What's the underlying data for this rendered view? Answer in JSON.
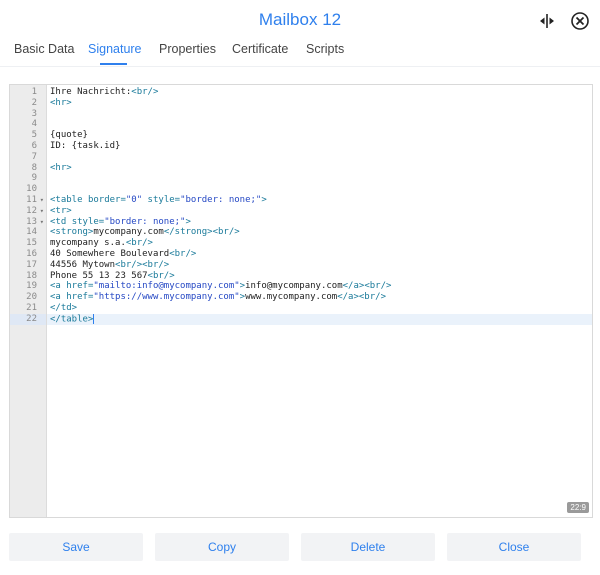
{
  "header": {
    "title": "Mailbox 12"
  },
  "tabs": [
    {
      "label": "Basic Data"
    },
    {
      "label": "Signature"
    },
    {
      "label": "Properties"
    },
    {
      "label": "Certificate"
    },
    {
      "label": "Scripts"
    }
  ],
  "icons": {
    "resize": "split-resize-icon",
    "close": "close-circle-icon"
  },
  "editor": {
    "active_line": 22,
    "cursor_position": "22:9",
    "lines": [
      {
        "n": "1",
        "fold": "",
        "segs": [
          [
            "txt",
            "Ihre Nachricht:"
          ],
          [
            "tag",
            "<br/>"
          ]
        ]
      },
      {
        "n": "2",
        "fold": "",
        "segs": [
          [
            "tag",
            "<hr>"
          ]
        ]
      },
      {
        "n": "3",
        "fold": "",
        "segs": []
      },
      {
        "n": "4",
        "fold": "",
        "segs": []
      },
      {
        "n": "5",
        "fold": "",
        "segs": [
          [
            "txt",
            "{quote}"
          ]
        ]
      },
      {
        "n": "6",
        "fold": "",
        "segs": [
          [
            "txt",
            "ID: {task.id}"
          ]
        ]
      },
      {
        "n": "7",
        "fold": "",
        "segs": []
      },
      {
        "n": "8",
        "fold": "",
        "segs": [
          [
            "tag",
            "<hr>"
          ]
        ]
      },
      {
        "n": "9",
        "fold": "",
        "segs": []
      },
      {
        "n": "10",
        "fold": "",
        "segs": []
      },
      {
        "n": "11",
        "fold": "▾",
        "segs": [
          [
            "tag",
            "<table "
          ],
          [
            "attr",
            "border="
          ],
          [
            "str",
            "\"0\""
          ],
          [
            "attr",
            " style="
          ],
          [
            "str",
            "\"border: none;\""
          ],
          [
            "tag",
            ">"
          ]
        ]
      },
      {
        "n": "12",
        "fold": "▾",
        "segs": [
          [
            "tag",
            "<tr>"
          ]
        ]
      },
      {
        "n": "13",
        "fold": "▾",
        "segs": [
          [
            "tag",
            "<td "
          ],
          [
            "attr",
            "style="
          ],
          [
            "str",
            "\"border: none;\""
          ],
          [
            "tag",
            ">"
          ]
        ]
      },
      {
        "n": "14",
        "fold": "",
        "segs": [
          [
            "tag",
            "<strong>"
          ],
          [
            "txt",
            "mycompany.com"
          ],
          [
            "tag",
            "</strong><br/>"
          ]
        ]
      },
      {
        "n": "15",
        "fold": "",
        "segs": [
          [
            "txt",
            "mycompany s.a."
          ],
          [
            "tag",
            "<br/>"
          ]
        ]
      },
      {
        "n": "16",
        "fold": "",
        "segs": [
          [
            "txt",
            "40 Somewhere Boulevard"
          ],
          [
            "tag",
            "<br/>"
          ]
        ]
      },
      {
        "n": "17",
        "fold": "",
        "segs": [
          [
            "txt",
            "44556 Mytown"
          ],
          [
            "tag",
            "<br/><br/>"
          ]
        ]
      },
      {
        "n": "18",
        "fold": "",
        "segs": [
          [
            "txt",
            "Phone 55 13 23 567"
          ],
          [
            "tag",
            "<br/>"
          ]
        ]
      },
      {
        "n": "19",
        "fold": "",
        "segs": [
          [
            "tag",
            "<a "
          ],
          [
            "attr",
            "href="
          ],
          [
            "str",
            "\"mailto:info@mycompany.com\""
          ],
          [
            "tag",
            ">"
          ],
          [
            "txt",
            "info@mycompany.com"
          ],
          [
            "tag",
            "</a><br/>"
          ]
        ]
      },
      {
        "n": "20",
        "fold": "",
        "segs": [
          [
            "tag",
            "<a "
          ],
          [
            "attr",
            "href="
          ],
          [
            "str",
            "\"https://www.mycompany.com\""
          ],
          [
            "tag",
            ">"
          ],
          [
            "txt",
            "www.mycompany.com"
          ],
          [
            "tag",
            "</a><br/>"
          ]
        ]
      },
      {
        "n": "21",
        "fold": "",
        "segs": [
          [
            "tag",
            "</td>"
          ]
        ]
      },
      {
        "n": "22",
        "fold": "",
        "segs": [
          [
            "tag",
            "</table>"
          ]
        ]
      }
    ]
  },
  "buttons": {
    "save": "Save",
    "copy": "Copy",
    "delete": "Delete",
    "close": "Close"
  },
  "colors": {
    "accent": "#2f80ed"
  }
}
